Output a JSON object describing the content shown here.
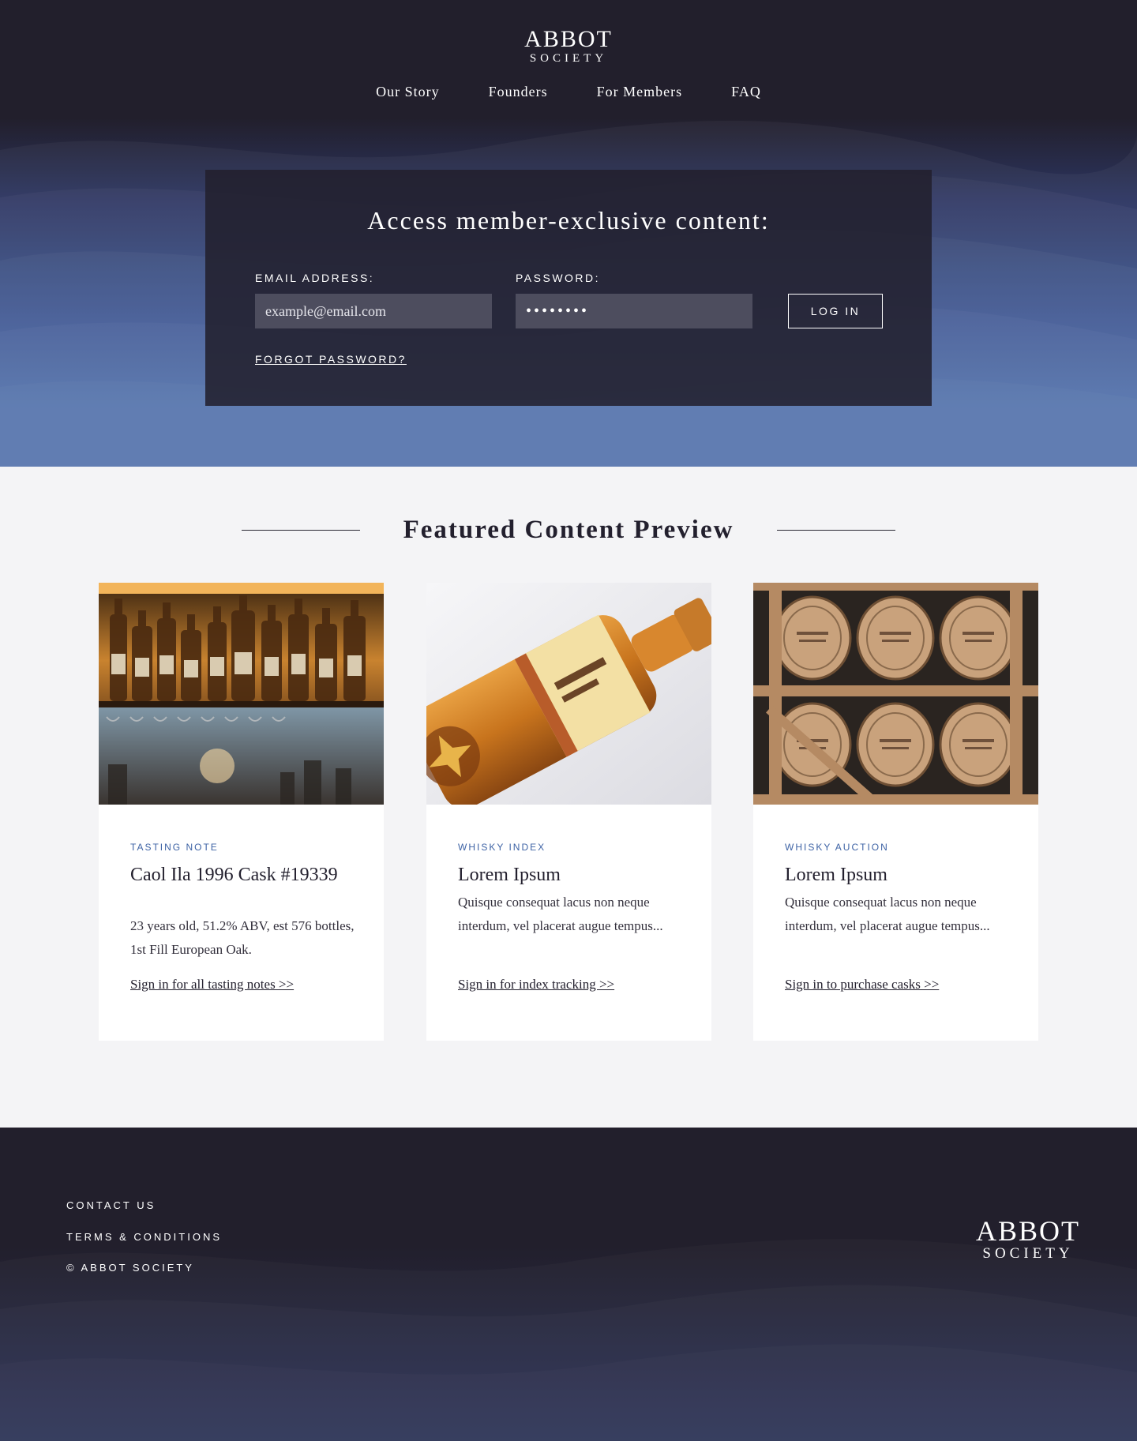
{
  "brand": {
    "line1": "ABBOT",
    "line2": "SOCIETY"
  },
  "nav": {
    "items": [
      "Our Story",
      "Founders",
      "For Members",
      "FAQ"
    ]
  },
  "login": {
    "title": "Access member-exclusive content:",
    "email_label": "EMAIL ADDRESS:",
    "email_placeholder": "example@email.com",
    "password_label": "PASSWORD:",
    "password_value": "••••••••",
    "button": "LOG IN",
    "forgot": "FORGOT PASSWORD?"
  },
  "featured": {
    "title": "Featured Content Preview",
    "cards": [
      {
        "tag": "TASTING NOTE",
        "title": "Caol Ila 1996 Cask #19339",
        "body": "23 years old, 51.2% ABV, est 576 bottles, 1st Fill European Oak.",
        "link": "Sign in for all tasting notes >>",
        "image": "bar-shelf-bottles"
      },
      {
        "tag": "WHISKY INDEX",
        "title": "Lorem Ipsum",
        "body": "Quisque consequat lacus non neque interdum, vel placerat augue tempus...",
        "link": "Sign in for index tracking >>",
        "image": "whisky-bottle"
      },
      {
        "tag": "WHISKY AUCTION",
        "title": "Lorem Ipsum",
        "body": "Quisque consequat lacus non neque interdum, vel placerat augue tempus...",
        "link": "Sign in to purchase casks >>",
        "image": "whisky-casks"
      }
    ]
  },
  "footer": {
    "contact": "CONTACT US",
    "terms": "TERMS & CONDITIONS",
    "copyright": "© ABBOT SOCIETY"
  },
  "colors": {
    "dark": "#221f2c",
    "accent_blue": "#4668a8",
    "tag_blue": "#3e63a5"
  }
}
